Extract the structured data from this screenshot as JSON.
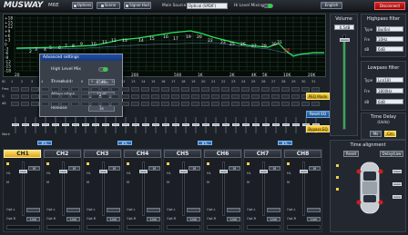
{
  "app": {
    "brand": "MUSWAY",
    "model": "M6E"
  },
  "toolbar": {
    "options": "Options",
    "scene": "Scene",
    "signal": "Signal Hud",
    "main_source_label": "Main Source",
    "main_source_value": "Optical (SPDIF)",
    "hi_level_mixing": "Hi Level Mixing",
    "language": "English",
    "disconnect": "Disconnect"
  },
  "graph": {
    "y_labels": [
      "+18",
      "+15",
      "+12",
      "+9",
      "+6",
      "+3",
      "0",
      "-3",
      "-6",
      "-9",
      "-12",
      "-15",
      "-18"
    ],
    "x_labels": [
      "20",
      "30",
      "50",
      "100",
      "200",
      "500",
      "1K",
      "2K",
      "4K",
      "5K",
      "10K",
      "20K"
    ],
    "markers": [
      "2",
      "3",
      "4",
      "5",
      "6",
      "7",
      "8",
      "9",
      "10",
      "11",
      "12",
      "13",
      "14",
      "15",
      "16",
      "17",
      "19",
      "20",
      "22",
      "23",
      "25",
      "26",
      "27",
      "29",
      "30",
      "31"
    ],
    "marker_red": "28"
  },
  "volume": {
    "title": "Volume",
    "value": "0.5dB"
  },
  "highpass": {
    "title": "Highpass filter",
    "type_label": "Type",
    "type_value": "Bu(6n)",
    "freq_label": "Fre",
    "freq_value": "10Hz",
    "q_label": "dB",
    "q_value": "6dB"
  },
  "lowpass": {
    "title": "Lowpass filter",
    "type_label": "Type",
    "type_value": "Lin(18)",
    "freq_label": "Fre",
    "freq_value": "1800Hz",
    "q_label": "dB",
    "q_value": "6dB"
  },
  "timedelay": {
    "title": "Time Delay",
    "unit": "(Units)",
    "value": "0.0",
    "ms": "Ms",
    "cm": "Cm"
  },
  "eq": {
    "row_id": "ID",
    "row_freq": "Freq",
    "row_q": "Q",
    "row_gain": "dB",
    "ids": [
      "1",
      "2",
      "3",
      "4",
      "5",
      "6",
      "7",
      "8",
      "9",
      "10",
      "11",
      "12",
      "13",
      "14",
      "15",
      "16",
      "17",
      "18",
      "19",
      "20",
      "21",
      "22",
      "23",
      "24",
      "25",
      "26",
      "27",
      "28",
      "29",
      "30",
      "31"
    ],
    "peq_mode": "PEQ Mode",
    "reset_eq": "Reset EQ",
    "bypass_eq": "Bypass EQ",
    "mark_label": "Work"
  },
  "dialog": {
    "title": "Advanced settings",
    "high_level_mix": "High Level Mix",
    "threshold_label": "Threshold",
    "threshold_value": "-65dBu",
    "attenuation_label": "Attenuation",
    "attenuation_value": "12dB",
    "release_label": "Release",
    "release_value": "3s"
  },
  "channels": [
    {
      "name": "CH1",
      "link": "BTL"
    },
    {
      "name": "CH2",
      "link": "BTL"
    },
    {
      "name": "CH3",
      "link": "BTL"
    },
    {
      "name": "CH4",
      "link": "BTL"
    },
    {
      "name": "CH5",
      "link": "BTL"
    },
    {
      "name": "CH6",
      "link": "BTL"
    },
    {
      "name": "CH7",
      "link": "BTL"
    },
    {
      "name": "CH8",
      "link": "BTL"
    }
  ],
  "channel_labels": {
    "hl": "HL",
    "mute": "M",
    "optl": "Opt-L",
    "optr": "Opt-R",
    "link": "Link"
  },
  "time_alignment": {
    "title": "Time alignment",
    "reset": "Reset",
    "delay_label": "Delay/Law"
  },
  "colors": {
    "accent": "#f7d04a",
    "graph_line": "#2ce55a",
    "warning_red": "#e81f1f",
    "highlight": "#1e4f8a"
  }
}
